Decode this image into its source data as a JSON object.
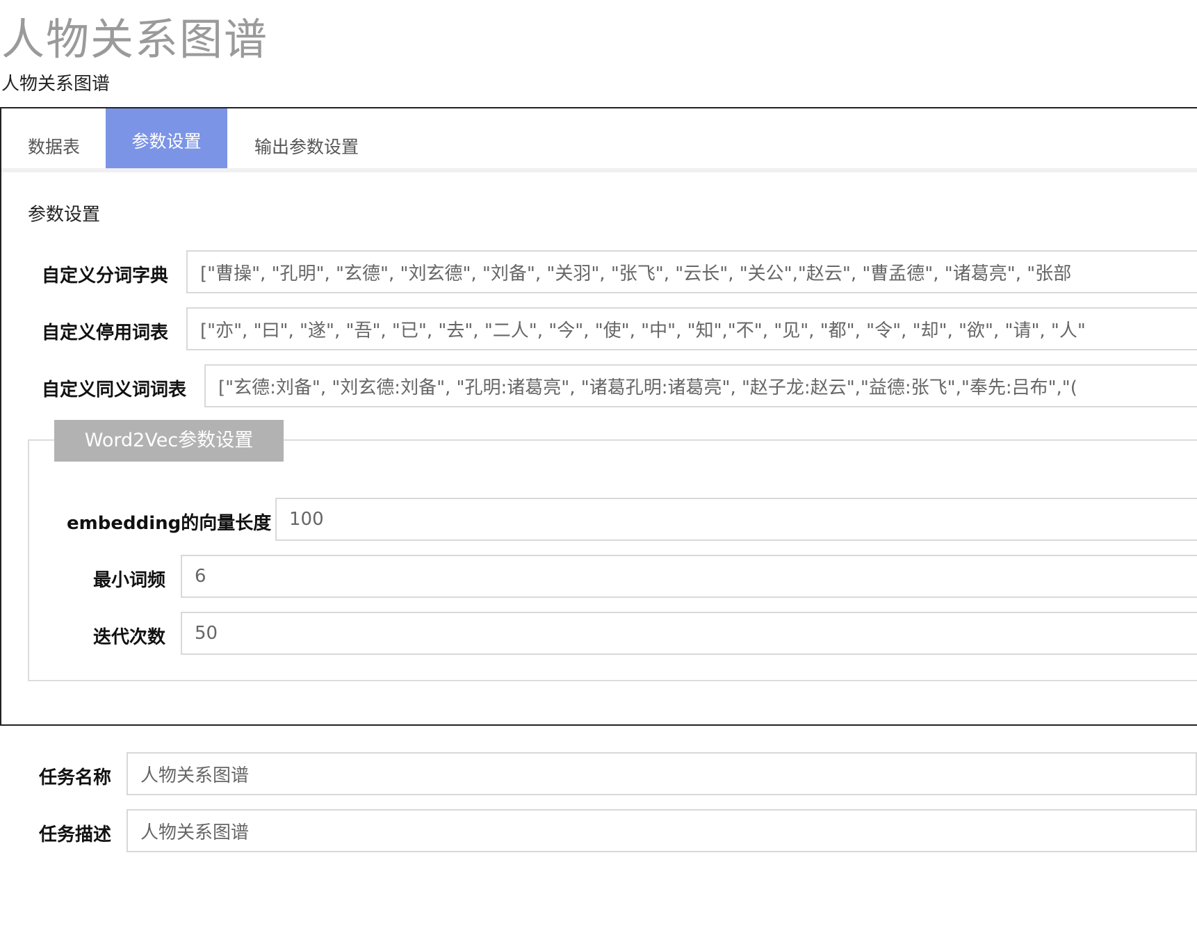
{
  "page": {
    "title": "人物关系图谱",
    "subtitle": "人物关系图谱"
  },
  "tabs": [
    {
      "label": "数据表",
      "active": false
    },
    {
      "label": "参数设置",
      "active": true
    },
    {
      "label": "输出参数设置",
      "active": false
    }
  ],
  "params": {
    "section_heading": "参数设置",
    "dict": {
      "label": "自定义分词字典",
      "value": "[\"曹操\", \"孔明\", \"玄德\", \"刘玄德\", \"刘备\", \"关羽\", \"张飞\", \"云长\", \"关公\",\"赵云\", \"曹孟德\", \"诸葛亮\", \"张部"
    },
    "stopwords": {
      "label": "自定义停用词表",
      "value": "[\"亦\", \"曰\", \"遂\", \"吾\", \"已\", \"去\", \"二人\", \"今\", \"使\", \"中\", \"知\",\"不\", \"见\", \"都\", \"令\", \"却\", \"欲\", \"请\", \"人\""
    },
    "synonyms": {
      "label": "自定义同义词词表",
      "value": "[\"玄德:刘备\", \"刘玄德:刘备\", \"孔明:诸葛亮\", \"诸葛孔明:诸葛亮\", \"赵子龙:赵云\",\"益德:张飞\",\"奉先:吕布\",\"("
    }
  },
  "word2vec": {
    "legend": "Word2Vec参数设置",
    "embedding": {
      "label": "embedding的向量长度",
      "value": "100"
    },
    "min_count": {
      "label": "最小词频",
      "value": "6"
    },
    "iterations": {
      "label": "迭代次数",
      "value": "50"
    }
  },
  "task": {
    "name": {
      "label": "任务名称",
      "value": "人物关系图谱"
    },
    "description": {
      "label": "任务描述",
      "value": "人物关系图谱"
    }
  },
  "colors": {
    "active_tab": "#7b94e6",
    "legend_bg": "#b2b2b2",
    "title": "#9a9a9a"
  }
}
